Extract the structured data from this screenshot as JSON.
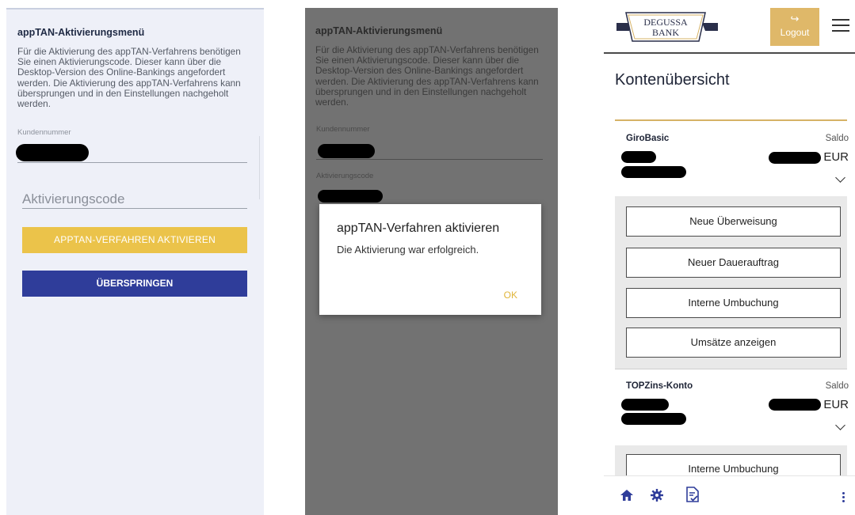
{
  "panel1": {
    "title": "appTAN-Aktivierungsmenü",
    "description": "Für die Aktivierung des appTAN-Verfahrens benötigen Sie einen Aktivierungscode. Dieser kann über die Desktop-Version des Online-Bankings angefordert werden. Die Aktivierung des appTAN-Verfahrens kann übersprungen und in den Einstellungen nachgeholt werden.",
    "customer_number_label": "Kundennummer",
    "activation_code_placeholder": "Aktivierungscode",
    "activate_button": "APPTAN-VERFAHREN AKTIVIEREN",
    "skip_button": "ÜBERSPRINGEN"
  },
  "panel2": {
    "title": "appTAN-Aktivierungsmenü",
    "description": "Für die Aktivierung des appTAN-Verfahrens benötigen Sie einen Aktivierungscode. Dieser kann über die Desktop-Version des Online-Bankings angefordert werden. Die Aktivierung des appTAN-Verfahrens kann übersprungen und in den Einstellungen nachgeholt werden.",
    "customer_number_label": "Kundennummer",
    "activation_code_label": "Aktivierungscode",
    "dialog": {
      "title": "appTAN-Verfahren aktivieren",
      "message": "Die Aktivierung war erfolgreich.",
      "ok": "OK"
    }
  },
  "panel3": {
    "logo_line1": "DEGUSSA",
    "logo_line2": "BANK",
    "logout_label": "Logout",
    "page_title": "Kontenübersicht",
    "accounts": [
      {
        "name": "GiroBasic",
        "saldo_label": "Saldo",
        "currency": "EUR",
        "actions": [
          "Neue Überweisung",
          "Neuer Dauerauftrag",
          "Interne Umbuchung",
          "Umsätze anzeigen"
        ]
      },
      {
        "name": "TOPZins-Konto",
        "saldo_label": "Saldo",
        "currency": "EUR",
        "actions": [
          "Interne Umbuchung"
        ]
      }
    ],
    "bottom_icons": [
      "home-icon",
      "settings-icon",
      "document-check-icon",
      "more-vertical-icon"
    ],
    "colors": {
      "gold": "#dfb869",
      "navy": "#2f3d9a",
      "yellow_button": "#ebc34a"
    }
  }
}
